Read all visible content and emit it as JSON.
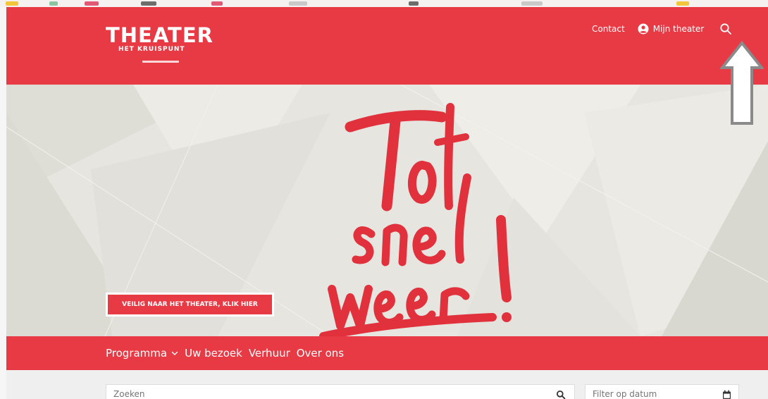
{
  "brand": {
    "title": "THEATER",
    "subtitle": "HET KRUISPUNT",
    "accent_color": "#e83a45",
    "hero_bg_color": "#e7e5df"
  },
  "utility_nav": {
    "contact_label": "Contact",
    "account_label": "Mijn theater",
    "account_icon": "user-circle-icon",
    "search_icon": "search-icon"
  },
  "hero": {
    "headline": "Tot snel weer!",
    "safety_button_label": "VEILIG NAAR HET THEATER, KLIK HIER"
  },
  "main_nav": {
    "items": [
      {
        "label": "Programma",
        "has_dropdown": true
      },
      {
        "label": "Uw bezoek"
      },
      {
        "label": "Verhuur"
      },
      {
        "label": "Over ons"
      }
    ]
  },
  "filters": {
    "search_placeholder": "Zoeken",
    "date_placeholder": "Filter op datum",
    "search_icon": "search-icon",
    "date_icon": "calendar-icon"
  },
  "annotation": {
    "arrow_icon": "arrow-up-icon"
  }
}
